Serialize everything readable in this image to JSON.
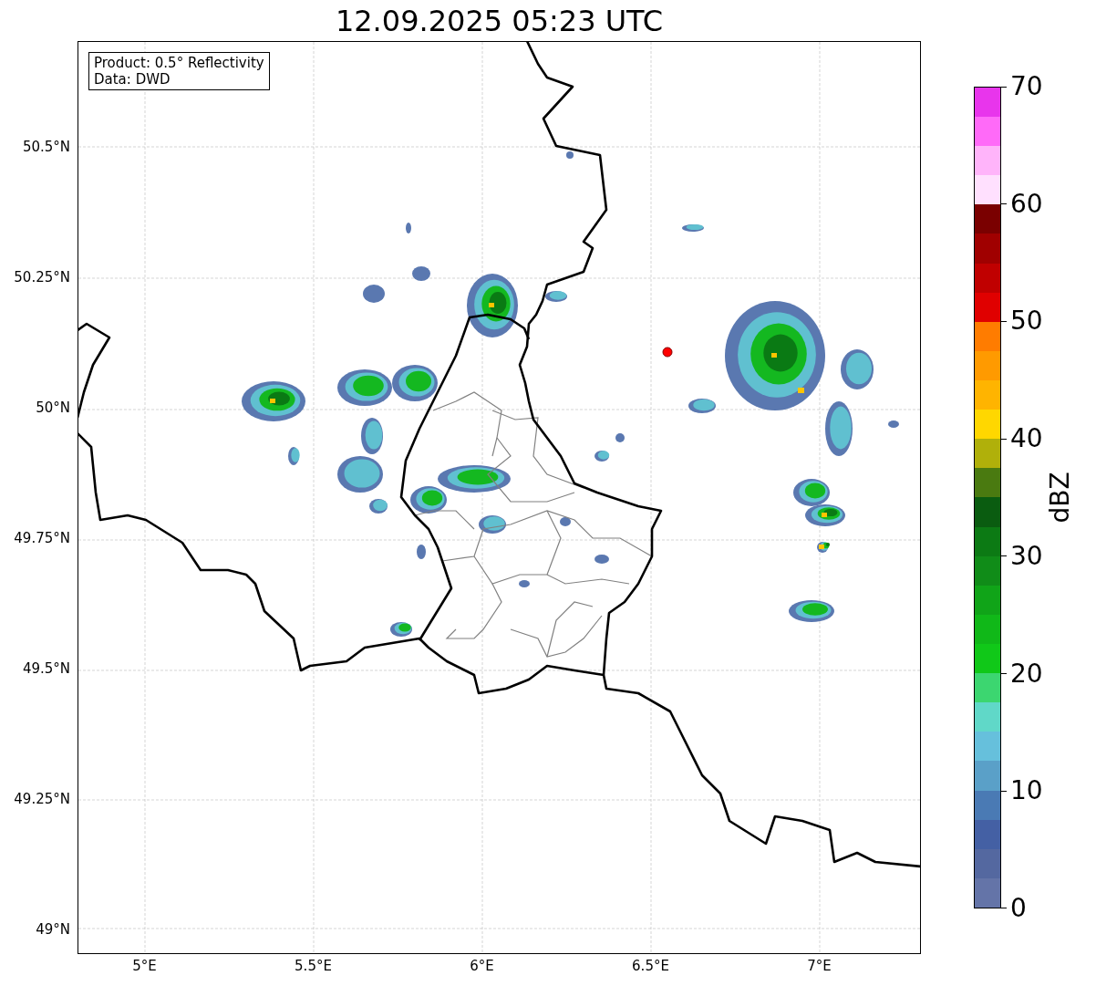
{
  "title": "12.09.2025 05:23 UTC",
  "info_box": [
    "Product: 0.5° Reflectivity",
    "Data: DWD"
  ],
  "map": {
    "y_ticks": [
      "50.5°N",
      "50.25°N",
      "50°N",
      "49.75°N",
      "49.5°N",
      "49.25°N",
      "49°N"
    ],
    "x_ticks": [
      "5°E",
      "5.5°E",
      "6°E",
      "6.5°E",
      "7°E"
    ]
  },
  "colorbar": {
    "label": "dBZ",
    "ticks": [
      "70",
      "60",
      "50",
      "40",
      "30",
      "20",
      "10",
      "0"
    ],
    "segments": [
      {
        "color": "#6474a8"
      },
      {
        "color": "#5468a0"
      },
      {
        "color": "#4460a4"
      },
      {
        "color": "#4a7ab4"
      },
      {
        "color": "#5aa0c8"
      },
      {
        "color": "#66c0dc"
      },
      {
        "color": "#60d8c8"
      },
      {
        "color": "#3cd670"
      },
      {
        "color": "#10c818"
      },
      {
        "color": "#10b818"
      },
      {
        "color": "#10a418"
      },
      {
        "color": "#108c18"
      },
      {
        "color": "#0c7a14"
      },
      {
        "color": "#0a5c10"
      },
      {
        "color": "#4a7a10"
      },
      {
        "color": "#b0b00a"
      },
      {
        "color": "#ffd700"
      },
      {
        "color": "#ffb400"
      },
      {
        "color": "#ff9a00"
      },
      {
        "color": "#ff7c00"
      },
      {
        "color": "#e00000"
      },
      {
        "color": "#c00000"
      },
      {
        "color": "#a00000"
      },
      {
        "color": "#7a0000"
      },
      {
        "color": "#ffe0fe"
      },
      {
        "color": "#ffb4fa"
      },
      {
        "color": "#ff6af8"
      },
      {
        "color": "#e835ec"
      }
    ]
  }
}
